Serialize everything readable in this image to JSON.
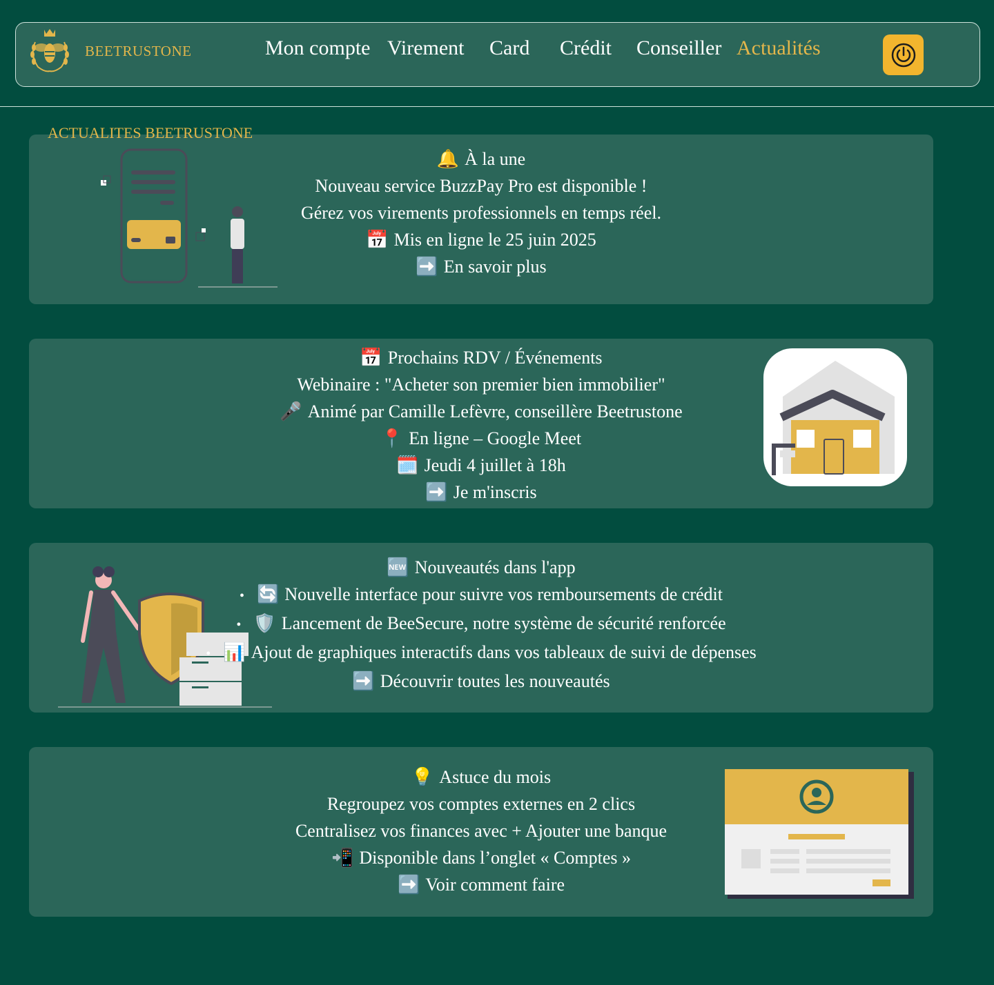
{
  "brand": {
    "name": "BEETRUSTONE",
    "logo_icon": "bee-crest-icon"
  },
  "nav": {
    "items": [
      {
        "label": "Mon compte"
      },
      {
        "label": "Virement"
      },
      {
        "label": "Card"
      },
      {
        "label": "Crédit"
      },
      {
        "label": "Conseiller"
      },
      {
        "label": "Actualités",
        "active": true
      }
    ],
    "power_icon": "power-icon"
  },
  "colors": {
    "background": "#024d3f",
    "card": "#2b6659",
    "accent": "#e3b64b",
    "button": "#f2b52e"
  },
  "section_title": "ACTUALITES BEETRUSTONE",
  "cards": [
    {
      "title_emoji": "🔔",
      "title": "À la une",
      "lines": [
        "Nouveau service BuzzPay Pro est disponible !",
        "Gérez vos virements professionnels en temps réel."
      ],
      "date_emoji": "📅",
      "date": "Mis en ligne le 25 juin 2025",
      "link_emoji": "➡️",
      "link": "En savoir plus",
      "illustration": "phone-payment-illustration"
    },
    {
      "title_emoji": "📅",
      "title": "Prochains RDV / Événements",
      "line1": "Webinaire : \"Acheter son premier bien immobilier\"",
      "host_emoji": "🎤",
      "host": "Animé par Camille Lefèvre, conseillère Beetrustone",
      "place_emoji": "📍",
      "place": "En ligne – Google Meet",
      "date_emoji": "🗓️",
      "date": "Jeudi 4 juillet à 18h",
      "link_emoji": "➡️",
      "link": "Je m'inscris",
      "illustration": "house-illustration"
    },
    {
      "title_emoji": "🆕",
      "title": "Nouveautés dans l'app",
      "bullets": [
        {
          "emoji": "🔄",
          "text": "Nouvelle interface pour suivre vos remboursements de crédit"
        },
        {
          "emoji": "🛡️",
          "text": "Lancement de BeeSecure, notre système de sécurité renforcée"
        },
        {
          "emoji": "📊",
          "text": "Ajout de graphiques interactifs dans vos tableaux de suivi de dépenses"
        }
      ],
      "link_emoji": "➡️",
      "link": "Découvrir toutes les nouveautés",
      "illustration": "security-shield-illustration"
    },
    {
      "title_emoji": "💡",
      "title": "Astuce du mois",
      "lines": [
        "Regroupez vos comptes externes en 2 clics",
        "Centralisez vos finances avec + Ajouter une banque"
      ],
      "info_emoji": "📲",
      "info": "Disponible dans l’onglet « Comptes »",
      "link_emoji": "➡️",
      "link": "Voir comment faire",
      "illustration": "profile-card-illustration"
    }
  ]
}
